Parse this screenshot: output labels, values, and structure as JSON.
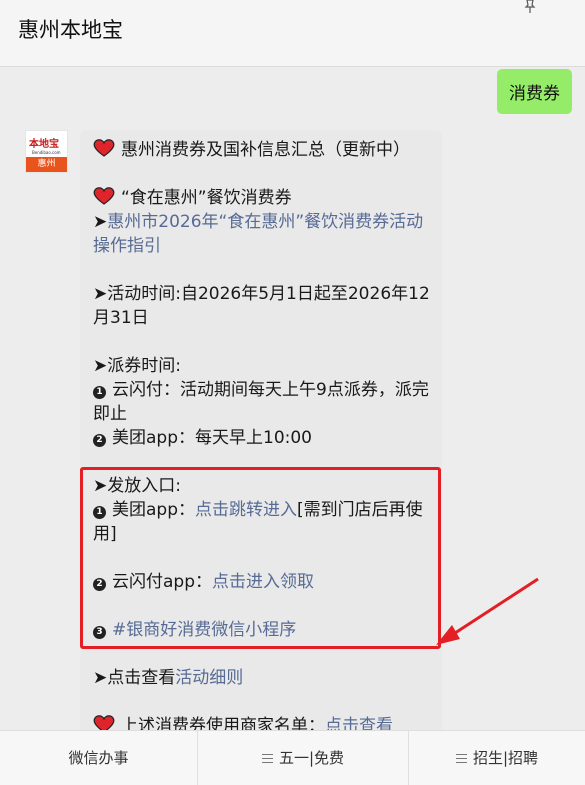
{
  "header": {
    "title": "惠州本地宝"
  },
  "sent_message": {
    "text": "消费券"
  },
  "avatar": {
    "top_text": "本地宝",
    "mid_text": "Bendibao.com",
    "bottom_text": "惠州"
  },
  "message": {
    "title": "惠州消费券及国补信息汇总（更新中）",
    "sub_title": "“食在惠州”餐饮消费券",
    "guide_prefix": "➤",
    "guide_link": "惠州市2026年“食在惠州”餐饮消费券活动操作指引",
    "activity_time": "➤活动时间:自2026年5月1日起至2026年12月31日",
    "dispatch_heading": "➤派券时间:",
    "dispatch_1_num": "❶",
    "dispatch_1": "云闪付：活动期间每天上午9点派券，派完即止",
    "dispatch_2_num": "❷",
    "dispatch_2": "美团app：每天早上10:00",
    "entry_heading": "➤发放入口:",
    "entry_1_prefix": "美团app：",
    "entry_1_link": "点击跳转进入",
    "entry_1_suffix": "[需到门店后再使用]",
    "entry_2_prefix": "云闪付app：",
    "entry_2_link": "点击进入领取",
    "entry_3_link": "#银商好消费微信小程序",
    "details_prefix": "➤点击查看",
    "details_link": "活动细则",
    "merchants_prefix": "上述消费券使用商家名单：",
    "merchants_link": "点击查看"
  },
  "footer": {
    "items": [
      {
        "label": "微信办事"
      },
      {
        "label": "五一|免费"
      },
      {
        "label": "招生|招聘"
      }
    ]
  },
  "colors": {
    "link": "#576b95",
    "sent_bubble": "#95ec69",
    "highlight": "#e31e24"
  }
}
